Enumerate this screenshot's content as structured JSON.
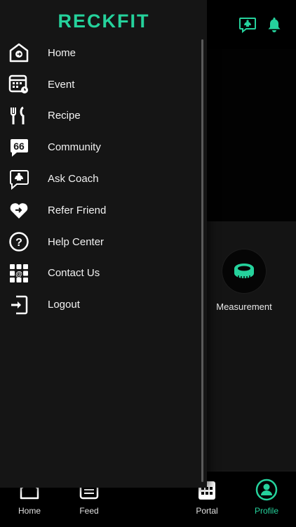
{
  "brand": {
    "logo_text": "RECKFIT",
    "accent_color": "#25d29c"
  },
  "header": {
    "icons": [
      "ask-coach-icon",
      "bell-icon"
    ]
  },
  "content": {
    "tiles": [
      {
        "label": "Measurement",
        "icon": "measuring-tape-icon"
      }
    ]
  },
  "drawer": {
    "items": [
      {
        "label": "Home",
        "icon": "home-icon"
      },
      {
        "label": "Event",
        "icon": "calendar-icon"
      },
      {
        "label": "Recipe",
        "icon": "fork-knife-icon"
      },
      {
        "label": "Community",
        "icon": "community-chat-icon"
      },
      {
        "label": "Ask Coach",
        "icon": "ask-coach-icon"
      },
      {
        "label": "Refer Friend",
        "icon": "heart-share-icon"
      },
      {
        "label": "Help Center",
        "icon": "help-icon"
      },
      {
        "label": "Contact Us",
        "icon": "contact-icon"
      },
      {
        "label": "Logout",
        "icon": "logout-icon"
      }
    ]
  },
  "bottom_nav": {
    "items": [
      {
        "label": "Home",
        "icon": "home-icon"
      },
      {
        "label": "Feed",
        "icon": "feed-icon"
      },
      {
        "label": "Portal",
        "icon": "portal-icon"
      },
      {
        "label": "Profile",
        "icon": "profile-icon",
        "active": true
      }
    ]
  }
}
